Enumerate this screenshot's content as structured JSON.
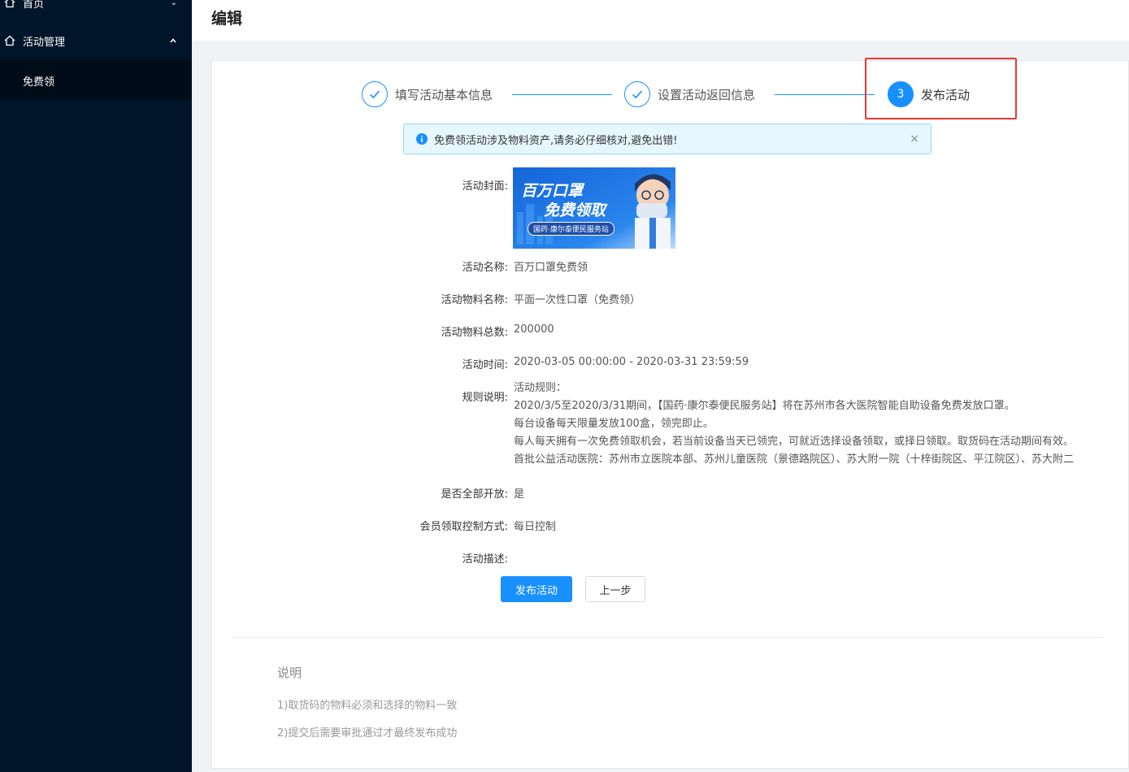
{
  "sidebar": {
    "home_label": "首页",
    "activity_label": "活动管理",
    "sub_item": "免费领"
  },
  "header": {
    "title": "编辑"
  },
  "steps": [
    {
      "label": "填写活动基本信息",
      "state": "done"
    },
    {
      "label": "设置活动返回信息",
      "state": "done"
    },
    {
      "number": "3",
      "label": "发布活动",
      "state": "active"
    }
  ],
  "alert": {
    "text": "免费领活动涉及物料资产,请务必仔细核对,避免出错!",
    "close": "×"
  },
  "form": {
    "cover_label": "活动封面:",
    "cover_image": {
      "title_line1": "百万口罩",
      "title_line2": "免费领取",
      "badge": "国药·康尔泰便民服务站"
    },
    "name_label": "活动名称:",
    "name_value": "百万口罩免费领",
    "material_label": "活动物料名称:",
    "material_value": "平面一次性口罩（免费领）",
    "total_label": "活动物料总数:",
    "total_value": "200000",
    "time_label": "活动时间:",
    "time_value": "2020-03-05 00:00:00 - 2020-03-31 23:59:59",
    "rules_label": "规则说明:",
    "rules_lines": [
      "活动规则：",
      "2020/3/5至2020/3/31期间，【国药·康尔泰便民服务站】将在苏州市各大医院智能自助设备免费发放口罩。",
      "每台设备每天限量发放100盒，领完即止。",
      "每人每天拥有一次免费领取机会，若当前设备当天已领完，可就近选择设备领取，或择日领取。取货码在活动期间有效。",
      "首批公益活动医院：苏州市立医院本部、苏州儿童医院（景德路院区）、苏大附一院（十梓街院区、平江院区）、苏大附二"
    ],
    "open_label": "是否全部开放:",
    "open_value": "是",
    "control_label": "会员领取控制方式:",
    "control_value": "每日控制",
    "desc_label": "活动描述:",
    "desc_value": ""
  },
  "buttons": {
    "publish": "发布活动",
    "prev": "上一步"
  },
  "notes": {
    "title": "说明",
    "lines": [
      "1)取货码的物料必须和选择的物料一致",
      "2)提交后需要审批通过才最终发布成功"
    ]
  },
  "colors": {
    "primary": "#1890ff",
    "sidebar": "#001529",
    "highlight": "#e53935"
  }
}
